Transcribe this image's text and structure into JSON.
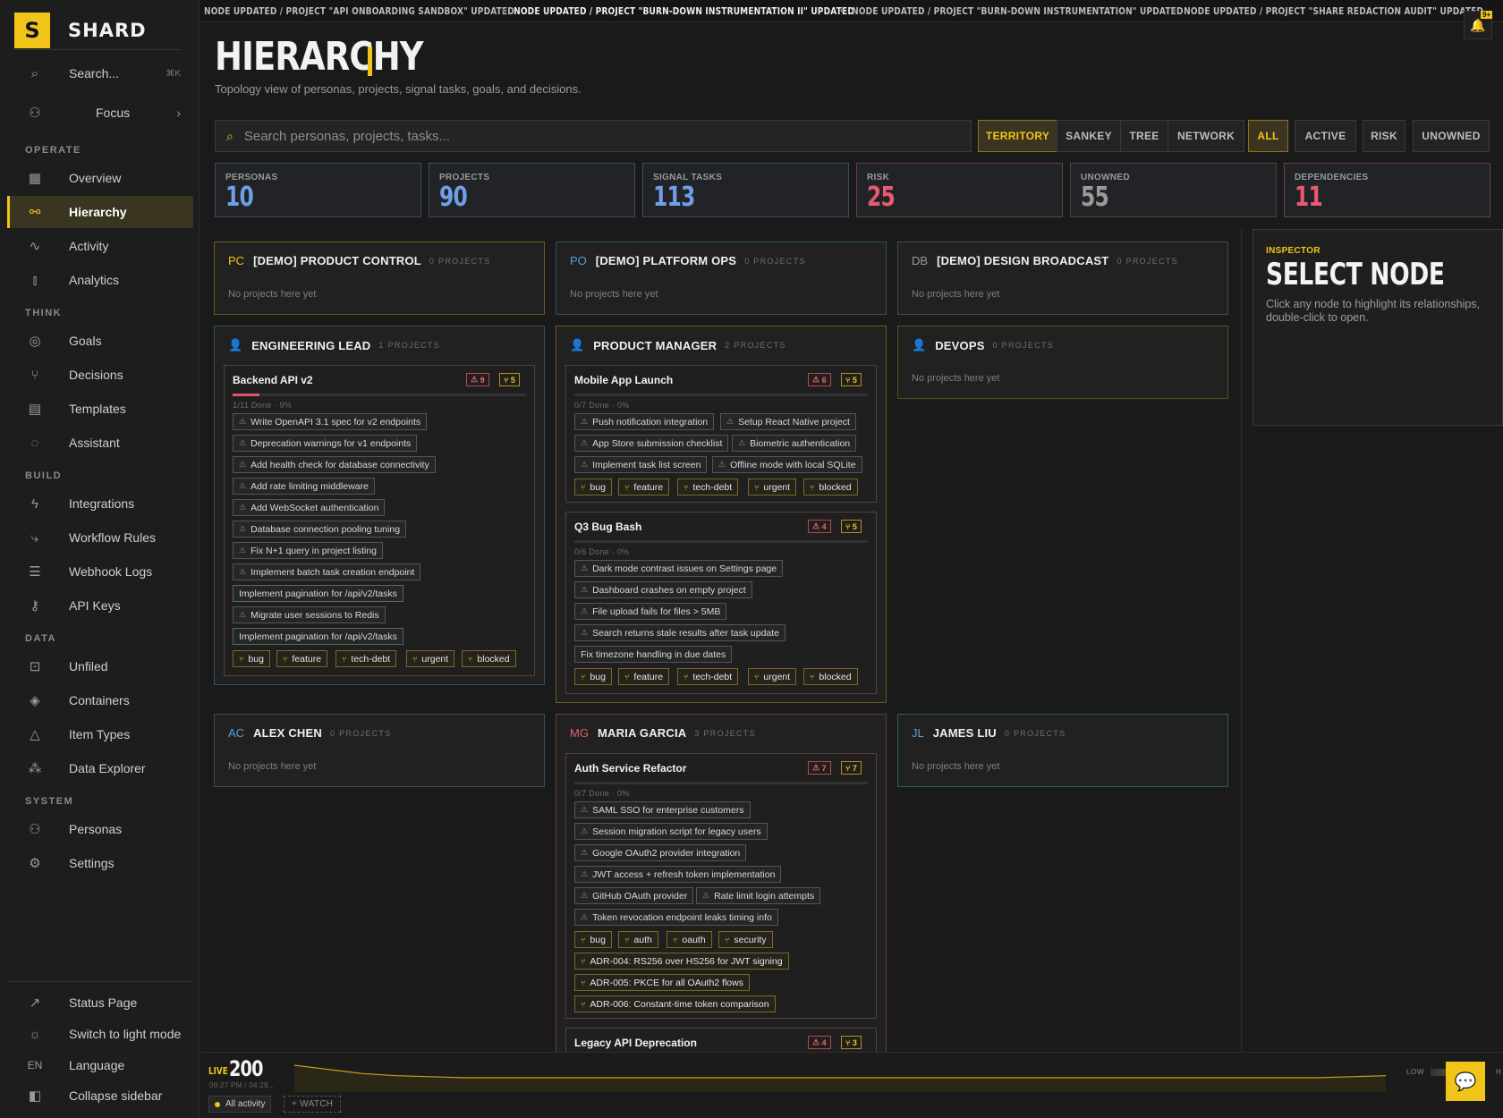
{
  "brand": {
    "logo": "S",
    "name": "SHARD"
  },
  "sidebar": {
    "search": {
      "label": "Search...",
      "shortcut": "⌘K"
    },
    "focus": {
      "label": "Focus"
    },
    "sections": {
      "operate": "OPERATE",
      "think": "THINK",
      "build": "BUILD",
      "data": "DATA",
      "system": "SYSTEM"
    },
    "items": {
      "overview": "Overview",
      "hierarchy": "Hierarchy",
      "activity": "Activity",
      "analytics": "Analytics",
      "goals": "Goals",
      "decisions": "Decisions",
      "templates": "Templates",
      "assistant": "Assistant",
      "integrations": "Integrations",
      "workflow_rules": "Workflow Rules",
      "webhook_logs": "Webhook Logs",
      "api_keys": "API Keys",
      "unfiled": "Unfiled",
      "containers": "Containers",
      "item_types": "Item Types",
      "data_explorer": "Data Explorer",
      "personas": "Personas",
      "settings": "Settings"
    },
    "footer": {
      "status_page": "Status Page",
      "light_mode": "Switch to light mode",
      "language_code": "EN",
      "language": "Language",
      "collapse": "Collapse sidebar"
    }
  },
  "ticker": [
    "NODE UPDATED / PROJECT \"API ONBOARDING SANDBOX\" UPDATED",
    "NODE UPDATED / PROJECT \"BURN-DOWN INSTRUMENTATION II\" UPDATED",
    "NODE UPDATED / PROJECT \"BURN-DOWN INSTRUMENTATION\" UPDATED",
    "NODE UPDATED / PROJECT \"SHARE REDACTION AUDIT\" UPDATED"
  ],
  "notifications": {
    "badge": "9+"
  },
  "header": {
    "title": "HIERARCHY",
    "subtitle": "Topology view of personas, projects, signal tasks, goals, and decisions."
  },
  "search": {
    "placeholder": "Search personas, projects, tasks..."
  },
  "views": [
    "TERRITORY",
    "SANKEY",
    "TREE",
    "NETWORK"
  ],
  "filters": [
    "ALL",
    "ACTIVE",
    "RISK",
    "UNOWNED"
  ],
  "stats": [
    {
      "label": "PERSONAS",
      "value": "10",
      "color": "#6f9fe6"
    },
    {
      "label": "PROJECTS",
      "value": "90",
      "color": "#6f9fe6"
    },
    {
      "label": "SIGNAL TASKS",
      "value": "113",
      "color": "#6f9fe6"
    },
    {
      "label": "RISK",
      "value": "25",
      "color": "#e85a6e"
    },
    {
      "label": "UNOWNED",
      "value": "55",
      "color": "#9a9a9a"
    },
    {
      "label": "DEPENDENCIES",
      "value": "11",
      "color": "#e85a6e"
    }
  ],
  "personas": [
    {
      "initials": "PC",
      "name": "[DEMO] PRODUCT CONTROL",
      "count": "0 PROJECTS",
      "empty": "No projects here yet",
      "color": "#f0c419"
    },
    {
      "initials": "PO",
      "name": "[DEMO] PLATFORM OPS",
      "count": "0 PROJECTS",
      "empty": "No projects here yet",
      "color": "#5aa0d8"
    },
    {
      "initials": "DB",
      "name": "[DEMO] DESIGN BROADCAST",
      "count": "0 PROJECTS",
      "empty": "No projects here yet",
      "color": "#9a9a9a"
    },
    {
      "initials": "👤",
      "name": "ENGINEERING LEAD",
      "count": "1 PROJECTS",
      "color": "#6f9fe6"
    },
    {
      "initials": "👤",
      "name": "PRODUCT MANAGER",
      "count": "2 PROJECTS",
      "color": "#f0c419"
    },
    {
      "initials": "👤",
      "name": "DEVOPS",
      "count": "0 PROJECTS",
      "empty": "No projects here yet",
      "color": "#5aa0d8"
    },
    {
      "initials": "AC",
      "name": "ALEX CHEN",
      "count": "0 PROJECTS",
      "empty": "No projects here yet",
      "color": "#5aa0d8"
    },
    {
      "initials": "MG",
      "name": "MARIA GARCIA",
      "count": "3 PROJECTS",
      "color": "#e06070"
    },
    {
      "initials": "JL",
      "name": "JAMES LIU",
      "count": "0 PROJECTS",
      "empty": "No projects here yet",
      "color": "#5aa0d8"
    }
  ],
  "projects": {
    "backend": {
      "title": "Backend API v2",
      "risk": "9",
      "deps": "5",
      "meta": "1/11 Done · 9%",
      "progress": 0.09,
      "tasks": [
        "Write OpenAPI 3.1 spec for v2 endpoints",
        "Deprecation warnings for v1 endpoints",
        "Add health check for database connectivity",
        "Add rate limiting middleware",
        "Add WebSocket authentication",
        "Database connection pooling tuning",
        "Fix N+1 query in project listing",
        "Implement batch task creation endpoint",
        "Implement pagination for /api/v2/tasks",
        "Migrate user sessions to Redis",
        "Implement pagination for /api/v2/tasks"
      ],
      "tags": [
        "bug",
        "feature",
        "tech-debt",
        "urgent",
        "blocked"
      ]
    },
    "mobile": {
      "title": "Mobile App Launch",
      "risk": "6",
      "deps": "5",
      "meta": "0/7 Done · 0%",
      "progress": 0,
      "tasks": [
        "Push notification integration",
        "Setup React Native project",
        "App Store submission checklist",
        "Biometric authentication",
        "Implement task list screen",
        "Offline mode with local SQLite"
      ],
      "tags": [
        "bug",
        "feature",
        "tech-debt",
        "urgent",
        "blocked"
      ]
    },
    "bugbash": {
      "title": "Q3 Bug Bash",
      "risk": "4",
      "deps": "5",
      "meta": "0/6 Done · 0%",
      "progress": 0,
      "tasks": [
        "Dark mode contrast issues on Settings page",
        "Dashboard crashes on empty project",
        "File upload fails for files > 5MB",
        "Search returns stale results after task update",
        "Fix timezone handling in due dates"
      ],
      "tags": [
        "bug",
        "feature",
        "tech-debt",
        "urgent",
        "blocked"
      ]
    },
    "auth": {
      "title": "Auth Service Refactor",
      "risk": "7",
      "deps": "7",
      "meta": "0/7 Done · 0%",
      "progress": 0,
      "tasks": [
        "SAML SSO for enterprise customers",
        "Session migration script for legacy users",
        "Google OAuth2 provider integration",
        "JWT access + refresh token implementation",
        "GitHub OAuth provider",
        "Rate limit login attempts",
        "Token revocation endpoint leaks timing info"
      ],
      "tags": [
        "bug",
        "auth",
        "oauth",
        "security"
      ],
      "decisions": [
        "ADR-004: RS256 over HS256 for JWT signing",
        "ADR-005: PKCE for all OAuth2 flows",
        "ADR-006: Constant-time token comparison"
      ]
    },
    "legacy": {
      "title": "Legacy API Deprecation",
      "risk": "4",
      "deps": "3"
    }
  },
  "inspector": {
    "kicker": "INSPECTOR",
    "title": "SELECT NODE",
    "desc": "Click any node to highlight its relationships, double-click to open."
  },
  "live": {
    "label": "LIVE",
    "value": "200",
    "time": "09:27 PM / 04:29...",
    "low": "LOW",
    "high": "H",
    "all_activity": "All activity",
    "watch": "+ WATCH",
    "series": [
      24,
      20,
      16,
      14,
      13,
      12,
      12,
      12,
      12,
      12,
      12,
      12,
      12,
      12,
      12,
      12,
      12,
      12,
      12,
      12,
      12,
      12,
      12,
      12,
      12,
      12,
      12,
      12,
      12,
      12,
      12,
      13,
      14
    ]
  }
}
